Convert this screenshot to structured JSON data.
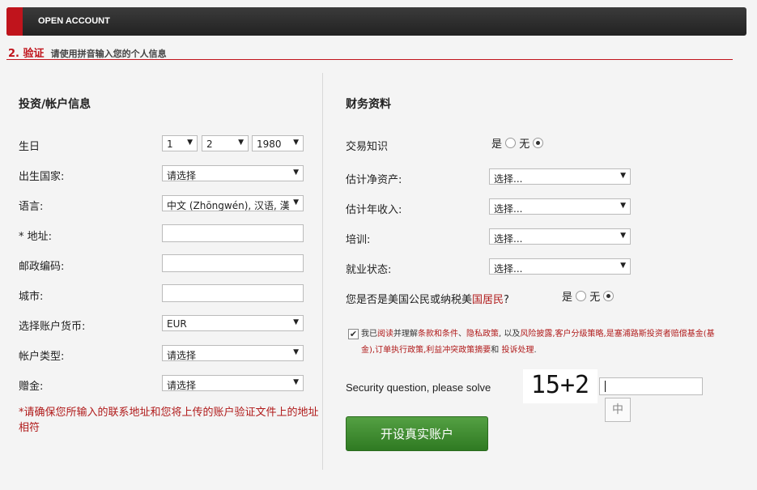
{
  "header": {
    "title": "OPEN ACCOUNT"
  },
  "step": {
    "number": "2. 验证",
    "subtitle": "请使用拼音输入您的个人信息"
  },
  "left": {
    "title": "投资/帐户信息",
    "birthday_label": "生日",
    "birth_day": "1",
    "birth_month": "2",
    "birth_year": "1980",
    "birth_country_label": "出生国家:",
    "birth_country_value": "请选择",
    "language_label": "语言:",
    "language_value": "中文 (Zhōngwén), 汉语, 漢",
    "address_label": "* 地址:",
    "postal_label": "邮政编码:",
    "city_label": "城市:",
    "currency_label": "选择账户货币:",
    "currency_value": "EUR",
    "account_type_label": "帐户类型:",
    "account_type_value": "请选择",
    "bonus_label": "赠金:",
    "bonus_value": "请选择",
    "note": "*请确保您所输入的联系地址和您将上传的账户验证文件上的地址相符"
  },
  "right": {
    "title": "财务资料",
    "trading_knowledge_label": "交易知识",
    "yes": "是",
    "no": "无",
    "net_worth_label": "估计净资产:",
    "net_worth_value": "选择...",
    "income_label": "估计年收入:",
    "income_value": "选择...",
    "training_label": "培训:",
    "training_value": "选择...",
    "employment_label": "就业状态:",
    "employment_value": "选择...",
    "us_citizen_label": "您是否是美国公民或纳税美",
    "us_citizen_link": "国居民",
    "us_citizen_q": "?",
    "agree_p1": "我已",
    "agree_p2": "阅读",
    "agree_p3": "并理解",
    "agree_p4": "条款和条件",
    "agree_p5": "、",
    "agree_p6": "隐私政策",
    "agree_p7": ", 以及",
    "agree_p8": "风险披露",
    "agree_p9": ",客户分级策略",
    "agree_p10": ",是塞浦路斯投资者赔偿基金(基金)",
    "agree_p11": ",订单执行政策",
    "agree_p12": ",利益冲突政策摘要",
    "agree_p13": "和",
    "agree_p14": "投诉处理",
    "agree_p15": ".",
    "security_label": "Security question, please solve",
    "captcha": "15+2",
    "ime": "中",
    "submit": "开设真实账户"
  }
}
